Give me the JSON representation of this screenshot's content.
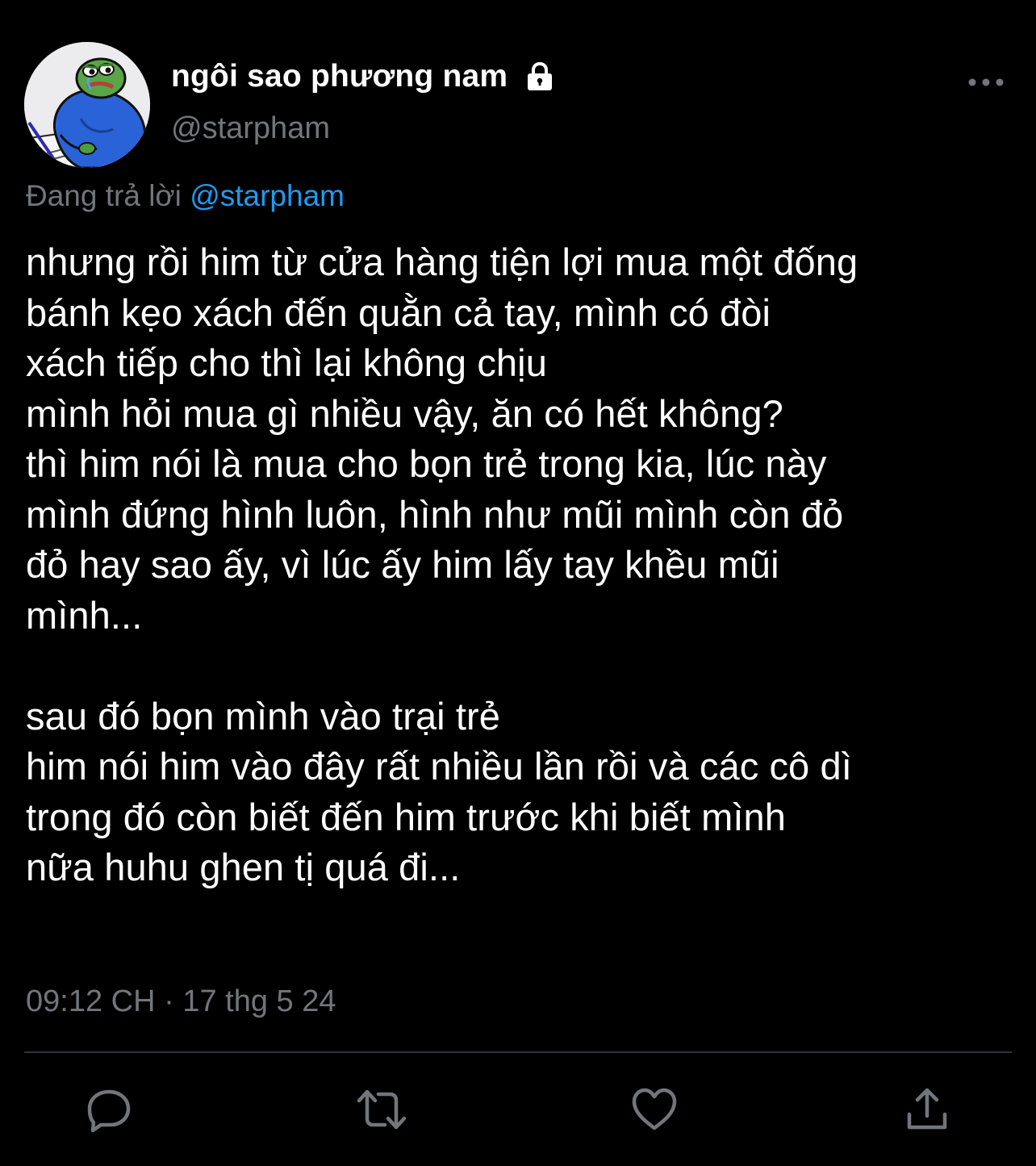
{
  "author": {
    "display_name": "ngôi sao phương nam",
    "handle": "@starpham",
    "protected_icon": "lock-icon",
    "avatar": "pepe-frog-avatar"
  },
  "reply_context": {
    "prefix": "Đang trả lời ",
    "mention": "@starpham"
  },
  "tweet": {
    "text": "nhưng rồi him từ cửa hàng tiện lợi mua một đống\nbánh kẹo xách đến quằn cả tay, mình có đòi\nxách tiếp cho thì lại không chịu\nmình hỏi mua gì nhiều vậy, ăn có hết không?\nthì him nói là mua cho bọn trẻ trong kia, lúc này\nmình đứng hình luôn, hình như mũi mình còn đỏ\nđỏ hay sao ấy, vì lúc ấy him lấy tay khều mũi\nmình...\n\nsau đó bọn mình vào trại trẻ\nhim nói him vào đây rất nhiều lần rồi và các cô dì\ntrong đó còn biết đến him trước khi biết mình\nnữa huhu ghen tị quá đi...",
    "timestamp": "09:12 CH · 17 thg 5 24"
  },
  "actions": {
    "reply_icon": "reply-icon",
    "retweet_icon": "retweet-icon",
    "like_icon": "heart-icon",
    "share_icon": "share-icon",
    "more_icon": "more-dots-icon"
  },
  "colors": {
    "background": "#000000",
    "text_primary": "#ffffff",
    "text_secondary": "#71767b",
    "link": "#1d9bf0",
    "divider": "#2f3336"
  }
}
